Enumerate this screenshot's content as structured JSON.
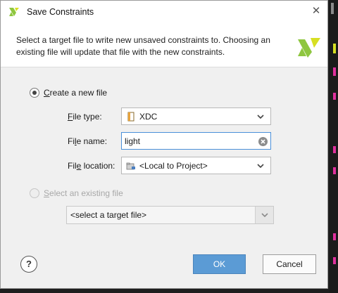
{
  "dialog": {
    "title": "Save Constraints",
    "close_glyph": "✕",
    "description": "Select a target file to write new unsaved constraints to. Choosing an existing file will update that file with the new constraints.",
    "logo_icon": "vivado-logo-icon"
  },
  "create_new": {
    "label_u": "C",
    "label_rest": "reate a new file",
    "checked": true,
    "file_type": {
      "label_u": "F",
      "label_rest": "ile type:",
      "value": "XDC",
      "icon": "file-icon"
    },
    "file_name": {
      "label_pre": "Fi",
      "label_u": "l",
      "label_rest": "e name:",
      "value": "light"
    },
    "file_location": {
      "label_pre": "Fil",
      "label_u": "e",
      "label_rest": " location:",
      "value": "<Local to Project>",
      "icon": "folder-location-icon"
    }
  },
  "select_existing": {
    "label_u": "S",
    "label_rest": "elect an existing file",
    "checked": false,
    "enabled": false,
    "placeholder": "<select a target file>"
  },
  "buttons": {
    "help": "?",
    "ok": "OK",
    "cancel": "Cancel"
  },
  "colors": {
    "accent": "#5b9bd5",
    "brand_green": "#8ec63f",
    "brand_yellow": "#d7df23"
  }
}
